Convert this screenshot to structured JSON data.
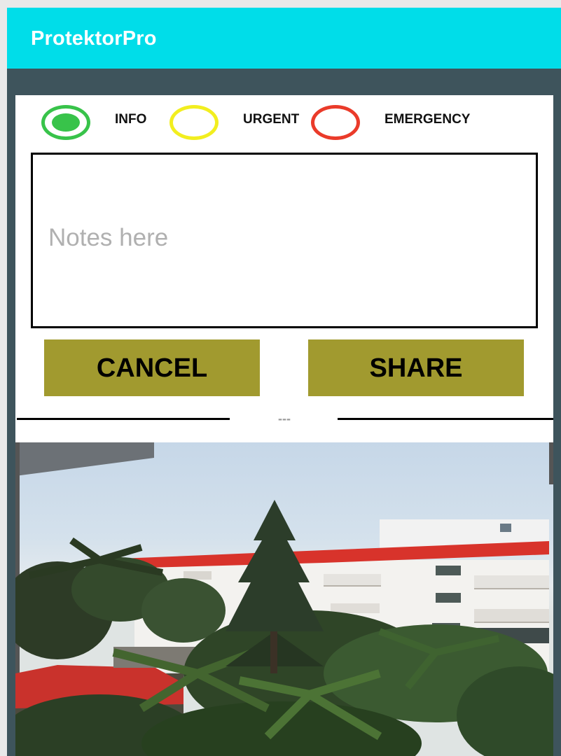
{
  "app": {
    "title": "ProtektorPro"
  },
  "priority": {
    "options": [
      {
        "label": "INFO",
        "color": "#38c34a",
        "selected": true
      },
      {
        "label": "URGENT",
        "color": "#f2ee1f",
        "selected": false
      },
      {
        "label": "EMERGENCY",
        "color": "#ea3b2a",
        "selected": false
      }
    ]
  },
  "notes": {
    "placeholder": "Notes here",
    "value": ""
  },
  "buttons": {
    "cancel": "CANCEL",
    "share": "SHARE"
  },
  "divider": {
    "text": "---"
  },
  "photo": {
    "description": ""
  }
}
